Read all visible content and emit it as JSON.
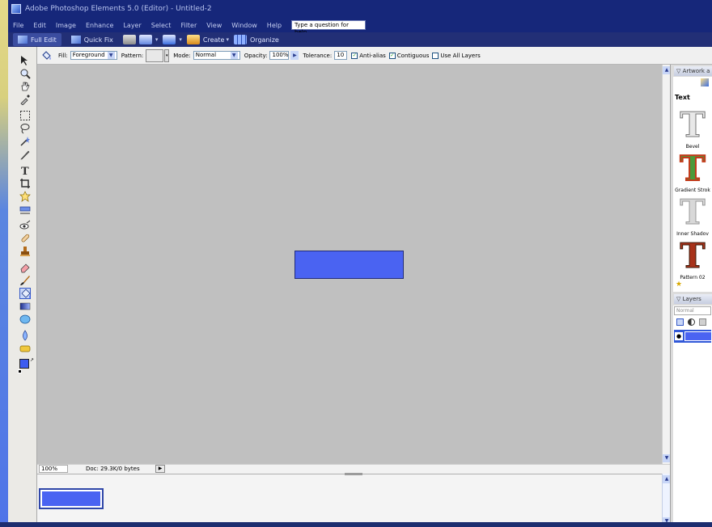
{
  "window": {
    "title": "Adobe Photoshop Elements 5.0 (Editor) - Untitled-2"
  },
  "menu": {
    "items": [
      "File",
      "Edit",
      "Image",
      "Enhance",
      "Layer",
      "Select",
      "Filter",
      "View",
      "Window",
      "Help"
    ],
    "help_placeholder": "Type a question for help"
  },
  "shortcuts": {
    "full_edit": "Full Edit",
    "quick_fix": "Quick Fix",
    "create": "Create",
    "organize": "Organize"
  },
  "options": {
    "fill_label": "Fill:",
    "fill_value": "Foreground",
    "pattern_label": "Pattern:",
    "mode_label": "Mode:",
    "mode_value": "Normal",
    "opacity_label": "Opacity:",
    "opacity_value": "100%",
    "tolerance_label": "Tolerance:",
    "tolerance_value": "10",
    "antialias_label": "Anti-alias",
    "antialias_checked": true,
    "contiguous_label": "Contiguous",
    "contiguous_checked": true,
    "use_all_layers_label": "Use All Layers",
    "use_all_layers_checked": false
  },
  "status": {
    "zoom": "100%",
    "doc_info": "Doc: 29.3K/0 bytes"
  },
  "artwork_panel": {
    "title": "Artwork a",
    "section": "Text",
    "styles": [
      "Bevel",
      "Gradient Strok",
      "Inner Shadov",
      "Pattern 02"
    ]
  },
  "layers_panel": {
    "title": "Layers",
    "blend_mode": "Normal"
  },
  "colors": {
    "foreground": "#3d5cf0",
    "background": "#ffff66",
    "shape_fill": "#4a63f2"
  }
}
